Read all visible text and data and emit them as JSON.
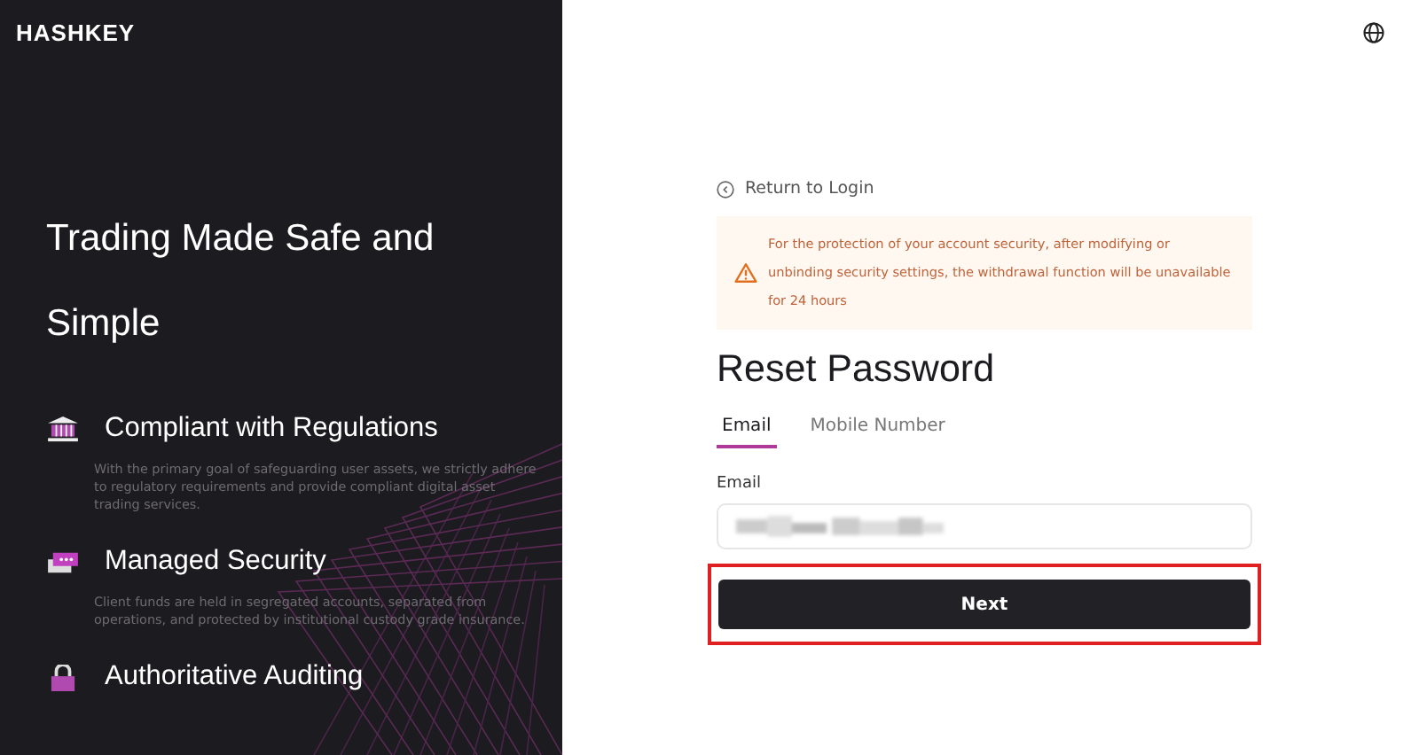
{
  "brand": {
    "logo": "HASHKEY"
  },
  "hero": {
    "title": "Trading Made Safe and Simple"
  },
  "features": [
    {
      "kind": "bank",
      "title": "Compliant with Regulations",
      "description": "With the primary goal of safeguarding user assets, we strictly adhere to regulatory requirements and provide compliant digital asset trading services."
    },
    {
      "kind": "card",
      "title": "Managed Security",
      "description": "Client funds are held in segregated accounts, separated from operations, and protected by institutional custody grade insurance."
    },
    {
      "kind": "lock",
      "title": "Authoritative Auditing"
    }
  ],
  "back_link": "Return to Login",
  "warning": "For the protection of your account security, after modifying or unbinding security settings, the withdrawal function will be unavailable for 24 hours",
  "form": {
    "title": "Reset Password",
    "tabs": [
      {
        "label": "Email",
        "selected": true
      },
      {
        "label": "Mobile Number",
        "selected": false
      }
    ],
    "field_label": "Email",
    "value_redacted": true,
    "button": "Next",
    "button_highlighted": true
  }
}
